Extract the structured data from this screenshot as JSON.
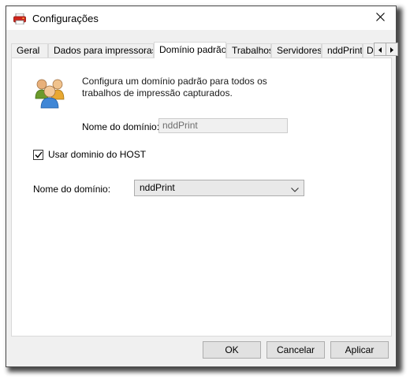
{
  "window": {
    "title": "Configurações",
    "close_glyph": "✕"
  },
  "tabs": [
    {
      "label": "Geral",
      "active": false
    },
    {
      "label": "Dados para impressoras",
      "active": false
    },
    {
      "label": "Domínio padrão",
      "active": true
    },
    {
      "label": "Trabalhos",
      "active": false
    },
    {
      "label": "Servidores",
      "active": false
    },
    {
      "label": "nddPrint",
      "active": false
    },
    {
      "label": "D",
      "active": false
    }
  ],
  "tab_scroll": {
    "left_icon": "arrow-left-icon",
    "right_icon": "arrow-right-icon"
  },
  "panel": {
    "icon": "users-icon",
    "description": "Configura um domínio padrão para todos os trabalhos de impressão capturados.",
    "domain_label": "Nome do domínio:",
    "domain_value": "nddPrint",
    "use_host_label": "Usar dominio do HOST",
    "use_host_checked": true,
    "host_domain_label": "Nome do domínio:",
    "host_domain_selected": "nddPrint"
  },
  "buttons": {
    "ok": "OK",
    "cancel": "Cancelar",
    "apply": "Aplicar"
  }
}
